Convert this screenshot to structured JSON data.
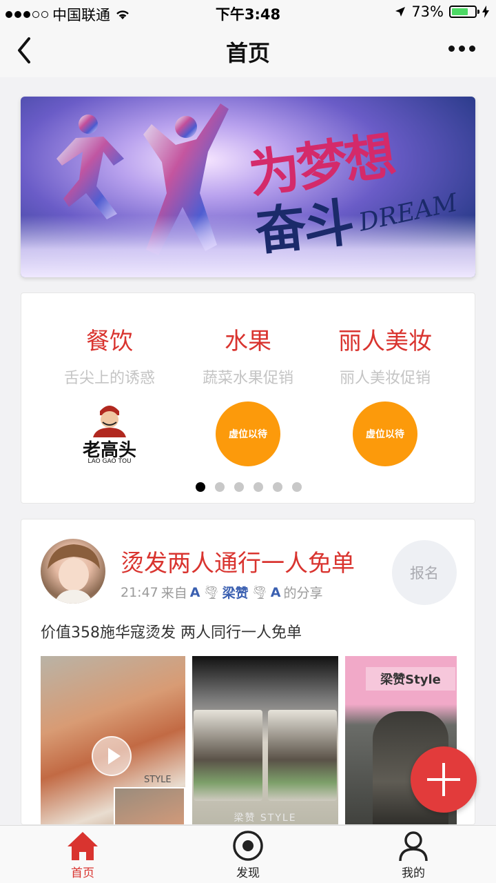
{
  "status_bar": {
    "carrier": "中国联通",
    "time": "下午3:48",
    "battery_percent": "73%",
    "battery_level": 0.73
  },
  "nav": {
    "title": "首页",
    "back_icon": "chevron-left-icon",
    "more_icon": "more-dots-icon"
  },
  "banner": {
    "line1": "为梦想",
    "line2": "奋斗",
    "english": "DREAM"
  },
  "categories": [
    {
      "title": "餐饮",
      "subtitle": "舌尖上的诱惑",
      "logo_text": "老高头",
      "logo_sub": "LAO GAO TOU"
    },
    {
      "title": "水果",
      "subtitle": "蔬菜水果促销",
      "placeholder": "虚位以待"
    },
    {
      "title": "丽人美妆",
      "subtitle": "丽人美妆促销",
      "placeholder": "虚位以待"
    }
  ],
  "pager": {
    "count": 6,
    "active": 0
  },
  "post": {
    "title": "烫发两人通行一人免单",
    "time": "21:47",
    "from_prefix": "来自",
    "user_a": "A",
    "user_name": "梁赞",
    "user_b": "A",
    "share_suffix": "的分享",
    "join_label": "报名",
    "description": "价值358施华寇烫发 两人同行一人免单",
    "photo1_watermark": "STYLE",
    "photo2_label": "梁赞 STYLE",
    "photo3_label": "梁赞Style"
  },
  "tabs": [
    {
      "label": "首页",
      "icon": "home-icon",
      "active": true
    },
    {
      "label": "发现",
      "icon": "discover-icon",
      "active": false
    },
    {
      "label": "我的",
      "icon": "profile-icon",
      "active": false
    }
  ],
  "colors": {
    "accent": "#d9342f",
    "placeholder": "#fc9a0b",
    "fab": "#e23b3b"
  }
}
